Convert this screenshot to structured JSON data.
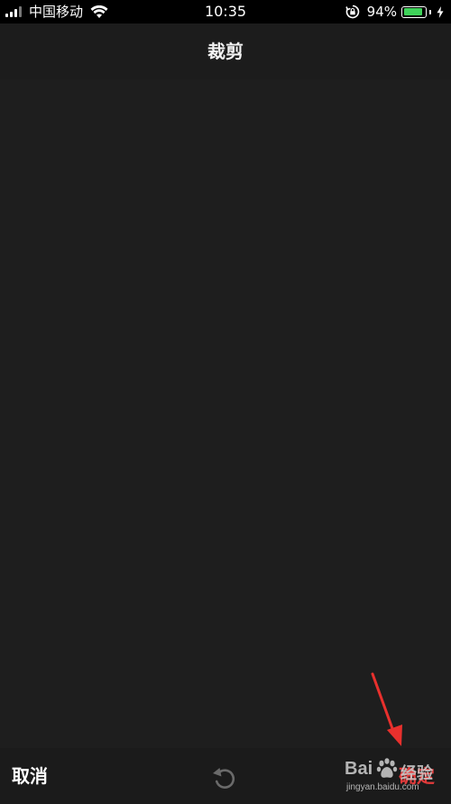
{
  "status_bar": {
    "carrier": "中国移动",
    "time": "10:35",
    "battery_percent": "94%",
    "battery_level": 0.94,
    "signal_bars_active": 3,
    "signal_bars_total": 4,
    "battery_color": "#3fd35a"
  },
  "nav": {
    "title": "裁剪"
  },
  "toolbar": {
    "cancel_label": "取消",
    "confirm_label": "确定",
    "confirm_color": "#e23a3a",
    "reset_icon": "rotate-ccw-icon"
  },
  "watermark": {
    "brand": "Bai",
    "brand_suffix": "经验",
    "url": "jingyan.baidu.com"
  },
  "annotation": {
    "arrow_color": "#e8302d"
  }
}
